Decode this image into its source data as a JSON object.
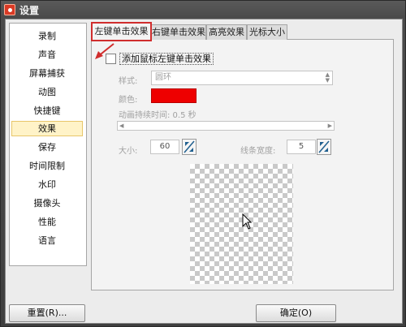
{
  "window": {
    "title": "设置",
    "icon": "app-icon"
  },
  "sidebar": {
    "items": [
      {
        "label": "录制"
      },
      {
        "label": "声音"
      },
      {
        "label": "屏幕捕获"
      },
      {
        "label": "动图"
      },
      {
        "label": "快捷键"
      },
      {
        "label": "效果",
        "selected": true
      },
      {
        "label": "保存"
      },
      {
        "label": "时间限制"
      },
      {
        "label": "水印"
      },
      {
        "label": "摄像头"
      },
      {
        "label": "性能"
      },
      {
        "label": "语言"
      }
    ]
  },
  "tabs": [
    {
      "label": "左键单击效果",
      "active": true
    },
    {
      "label": "右键单击效果"
    },
    {
      "label": "高亮效果"
    },
    {
      "label": "光标大小"
    }
  ],
  "left_click": {
    "enable_label": "添加鼠标左键单击效果",
    "enabled": false,
    "style_label": "样式:",
    "style_value": "圆环",
    "color_label": "颜色:",
    "color_value": "#ee0000",
    "duration_label": "动画持续时间: 0.5 秒",
    "size_label": "大小:",
    "size_value": "60",
    "line_width_label": "线条宽度:",
    "line_width_value": "5"
  },
  "buttons": {
    "reset": "重置(R)...",
    "ok": "确定(O)"
  },
  "colors": {
    "highlight": "#d02d2d",
    "selected_bg": "#fff3c8"
  }
}
